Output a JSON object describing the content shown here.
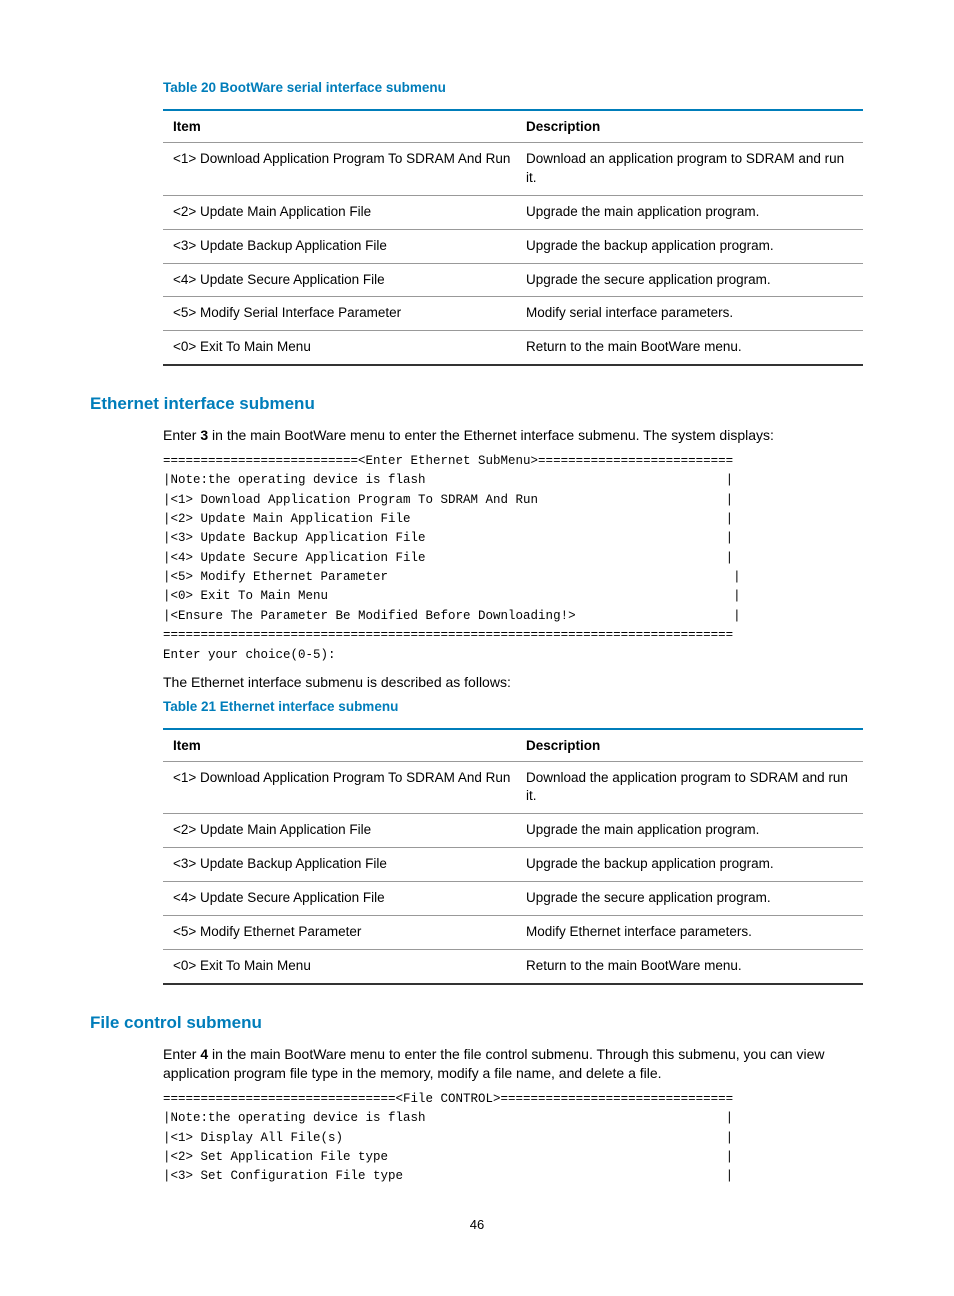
{
  "table20": {
    "title": "Table 20 BootWare serial interface submenu",
    "head_item": "Item",
    "head_desc": "Description",
    "rows": [
      {
        "item": "<1> Download Application Program To SDRAM And Run",
        "desc": "Download an application program to SDRAM and run it."
      },
      {
        "item": "<2> Update Main Application File",
        "desc": "Upgrade the main application program."
      },
      {
        "item": "<3> Update Backup Application File",
        "desc": "Upgrade the backup application program."
      },
      {
        "item": "<4> Update Secure Application File",
        "desc": "Upgrade the secure application program."
      },
      {
        "item": "<5> Modify Serial Interface Parameter",
        "desc": "Modify serial interface parameters."
      },
      {
        "item": "<0> Exit To Main Menu",
        "desc": "Return to the main BootWare menu."
      }
    ]
  },
  "eth_section": {
    "heading": "Ethernet interface submenu",
    "intro_pre": "Enter ",
    "intro_bold": "3",
    "intro_post": " in the main BootWare menu to enter the Ethernet interface submenu. The system displays:",
    "pre": "==========================<Enter Ethernet SubMenu>==========================\n|Note:the operating device is flash                                        |\n|<1> Download Application Program To SDRAM And Run                         |\n|<2> Update Main Application File                                          |\n|<3> Update Backup Application File                                        |\n|<4> Update Secure Application File                                        |\n|<5> Modify Ethernet Parameter                                              |\n|<0> Exit To Main Menu                                                      |\n|<Ensure The Parameter Be Modified Before Downloading!>                     |\n============================================================================\nEnter your choice(0-5):",
    "after_pre": "The Ethernet interface submenu is described as follows:"
  },
  "table21": {
    "title": "Table 21 Ethernet interface submenu",
    "head_item": "Item",
    "head_desc": "Description",
    "rows": [
      {
        "item": "<1> Download Application Program To SDRAM And Run",
        "desc": "Download the application program to SDRAM and run it."
      },
      {
        "item": "<2> Update Main Application File",
        "desc": "Upgrade the main application program."
      },
      {
        "item": "<3> Update Backup Application File",
        "desc": "Upgrade the backup application program."
      },
      {
        "item": "<4> Update Secure Application File",
        "desc": "Upgrade the secure application program."
      },
      {
        "item": "<5> Modify Ethernet Parameter",
        "desc": "Modify Ethernet interface parameters."
      },
      {
        "item": "<0> Exit To Main Menu",
        "desc": "Return to the main BootWare menu."
      }
    ]
  },
  "file_section": {
    "heading": "File control submenu",
    "intro_pre": "Enter ",
    "intro_bold": "4",
    "intro_post": " in the main BootWare menu to enter the file control submenu. Through this submenu, you can view application program file type in the memory, modify a file name, and delete a file.",
    "pre": "===============================<File CONTROL>===============================\n|Note:the operating device is flash                                        |\n|<1> Display All File(s)                                                   |\n|<2> Set Application File type                                             |\n|<3> Set Configuration File type                                           |"
  },
  "page_number": "46"
}
